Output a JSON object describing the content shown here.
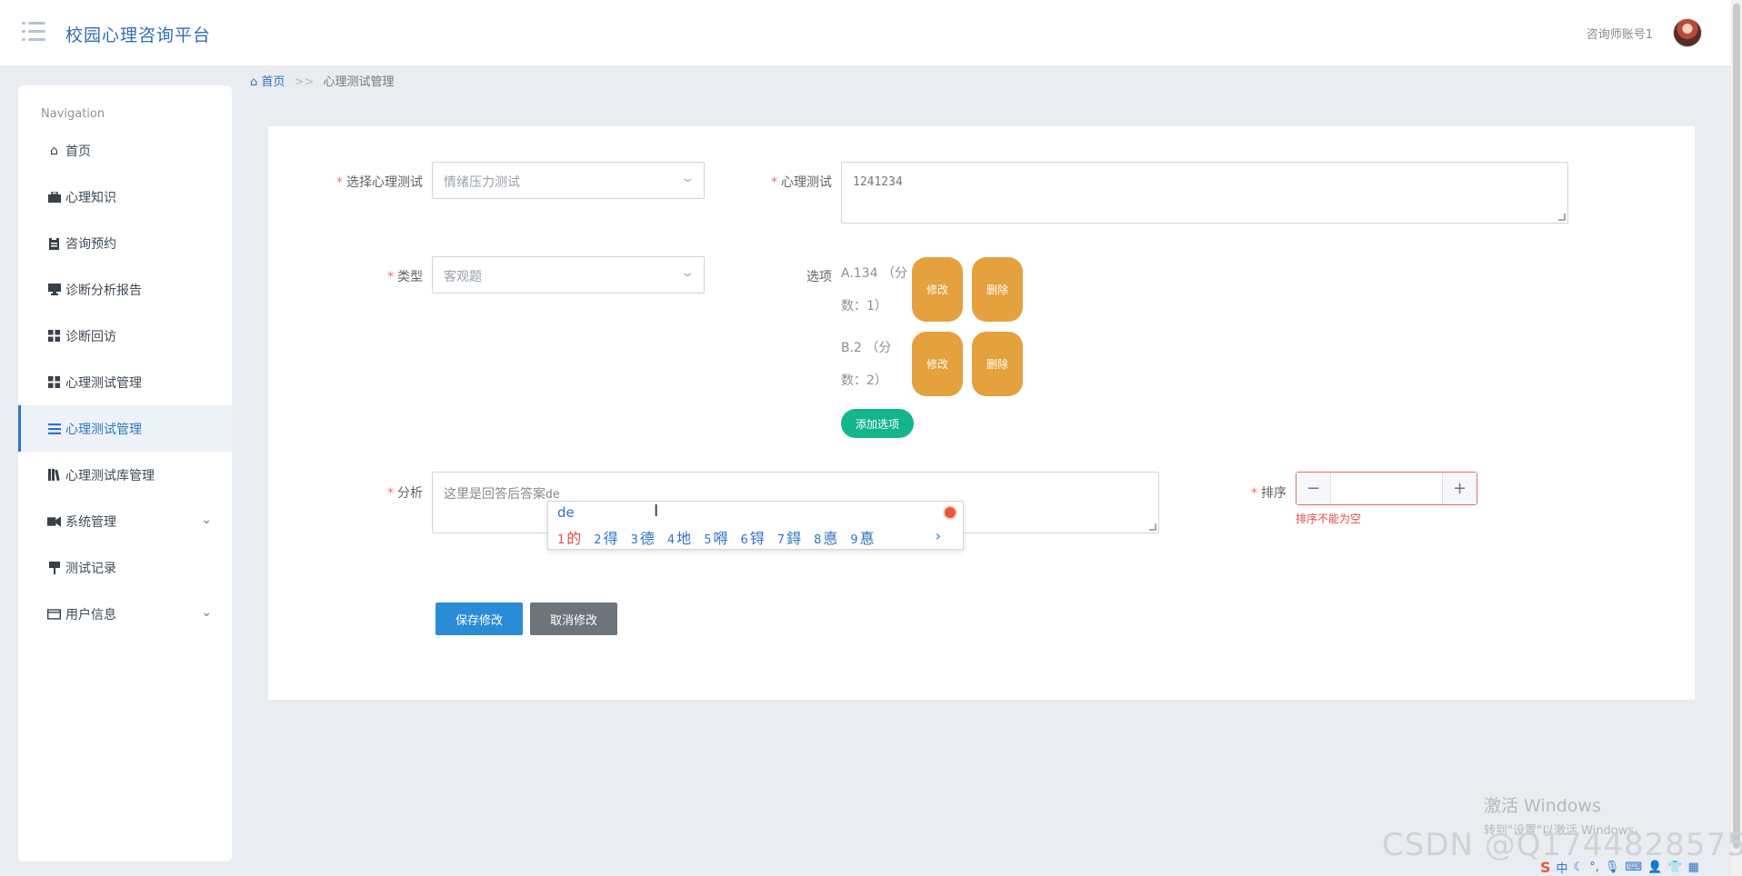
{
  "header": {
    "app_title": "校园心理咨询平台",
    "account_name": "咨询师账号1"
  },
  "sidebar": {
    "nav_title": "Navigation",
    "items": [
      {
        "label": "首页",
        "icon": "home-icon"
      },
      {
        "label": "心理知识",
        "icon": "briefcase-icon"
      },
      {
        "label": "咨询预约",
        "icon": "clipboard-icon"
      },
      {
        "label": "诊断分析报告",
        "icon": "monitor-icon"
      },
      {
        "label": "诊断回访",
        "icon": "grid-icon"
      },
      {
        "label": "心理测试管理",
        "icon": "grid-icon"
      },
      {
        "label": "心理测试管理",
        "icon": "list-icon",
        "active": true
      },
      {
        "label": "心理测试库管理",
        "icon": "library-icon"
      },
      {
        "label": "系统管理",
        "icon": "video-icon",
        "expandable": true
      },
      {
        "label": "测试记录",
        "icon": "pin-icon"
      },
      {
        "label": "用户信息",
        "icon": "card-icon",
        "expandable": true
      }
    ]
  },
  "breadcrumb": {
    "home": "首页",
    "separator": ">>",
    "current": "心理测试管理"
  },
  "form": {
    "select_test_label": "选择心理测试",
    "select_test_value": "情绪压力测试",
    "question_label": "心理测试",
    "question_value": "1241234",
    "type_label": "类型",
    "type_value": "客观题",
    "options_label": "选项",
    "options": [
      {
        "line1": "A.134 （分",
        "line2": "数：1）",
        "edit_label": "修改",
        "delete_label": "删除"
      },
      {
        "line1": "B.2 （分",
        "line2": "数：2）",
        "edit_label": "修改",
        "delete_label": "删除"
      }
    ],
    "add_option_label": "添加选项",
    "analysis_label": "分析",
    "analysis_value": "这里是回答后答案",
    "analysis_composing": "de",
    "sort_label": "排序",
    "sort_minus": "−",
    "sort_plus": "+",
    "sort_error": "排序不能为空",
    "save_label": "保存修改",
    "cancel_label": "取消修改"
  },
  "ime": {
    "composition": "de",
    "candidates": [
      {
        "num": "1",
        "char": "的"
      },
      {
        "num": "2",
        "char": "得"
      },
      {
        "num": "3",
        "char": "德"
      },
      {
        "num": "4",
        "char": "地"
      },
      {
        "num": "5",
        "char": "嘚"
      },
      {
        "num": "6",
        "char": "锝"
      },
      {
        "num": "7",
        "char": "鍀"
      },
      {
        "num": "8",
        "char": "悳"
      },
      {
        "num": "9",
        "char": "惪"
      }
    ],
    "next": "›"
  },
  "watermark": {
    "windows_line1": "激活 Windows",
    "windows_line2": "转到\"设置\"以激活 Windows。",
    "csdn": "CSDN @Q1744828575"
  },
  "tray": {
    "logo": "S",
    "lang": "中"
  },
  "colors": {
    "accent": "#2f74c2",
    "warning": "#e4a13e",
    "success": "#13b58c",
    "danger": "#e34c4c"
  }
}
